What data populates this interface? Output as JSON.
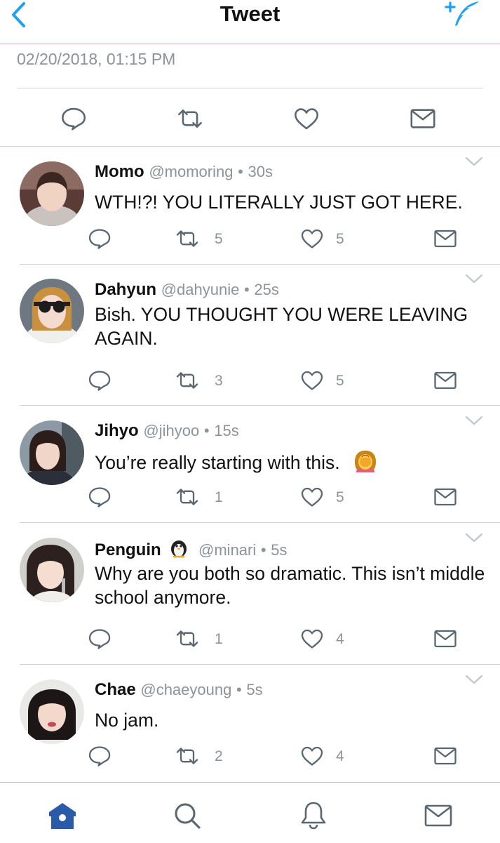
{
  "header": {
    "title": "Tweet",
    "back_icon": "chevron-left-icon",
    "compose_icon": "feather-quill-icon"
  },
  "timestamp": "02/20/2018, 01:15 PM",
  "main_actions": [
    "reply-icon",
    "retweet-icon",
    "like-icon",
    "message-icon"
  ],
  "replies": [
    {
      "name": "Momo",
      "handle": "@momoring",
      "dot": "•",
      "time": "30s",
      "text": "WTH!?! YOU LITERALLY JUST GOT HERE.",
      "retweets": "5",
      "likes": "5"
    },
    {
      "name": "Dahyun",
      "handle": "@dahyunie",
      "dot": "•",
      "time": "25s",
      "text": "Bish. YOU THOUGHT YOU WERE LEAVING AGAIN.",
      "retweets": "3",
      "likes": "5"
    },
    {
      "name": "Jihyo",
      "handle": "@jihyoo",
      "dot": "•",
      "time": "15s",
      "text": "You’re really starting with this.",
      "retweets": "1",
      "likes": "5"
    },
    {
      "name": "Penguin",
      "handle": "@minari",
      "dot": "•",
      "time": "5s",
      "text": "Why are you both so dramatic. This isn’t middle school anymore.",
      "retweets": "1",
      "likes": "4"
    },
    {
      "name": "Chae",
      "handle": "@chaeyoung",
      "dot": "•",
      "time": "5s",
      "text": "No jam.",
      "retweets": "2",
      "likes": "4"
    }
  ],
  "tab_bar": [
    "home-icon",
    "search-icon",
    "bell-icon",
    "messages-icon"
  ],
  "colors": {
    "accent": "#1da1f2",
    "nav_active": "#2a5ba8",
    "icon_gray": "#5b6770",
    "meta_gray": "#8c9399"
  }
}
